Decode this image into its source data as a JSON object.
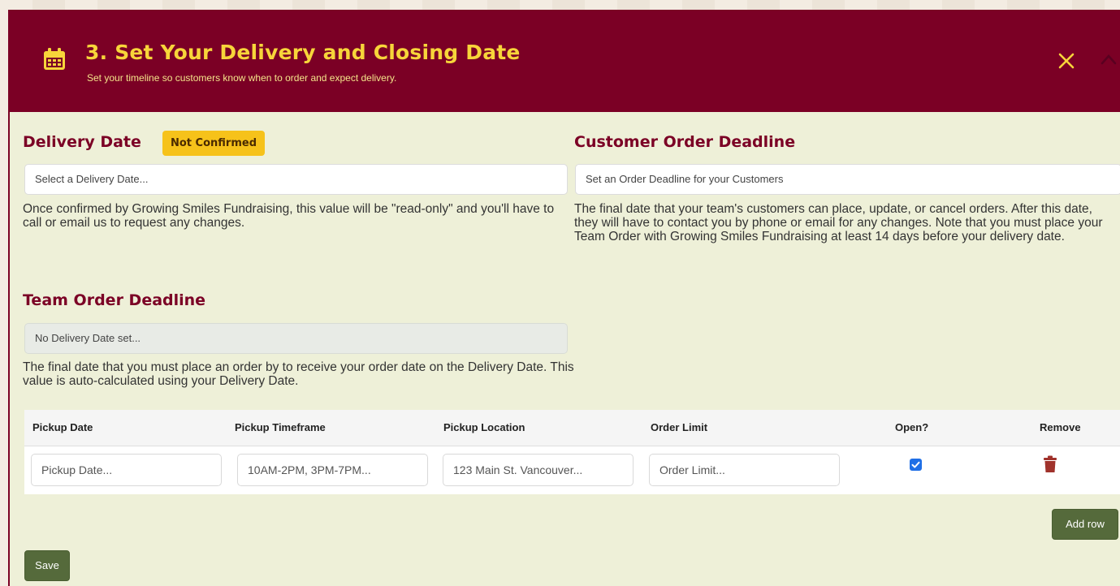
{
  "header": {
    "title": "3. Set Your Delivery and Closing Date",
    "subtitle": "Set your timeline so customers know when to order and expect delivery.",
    "icon": "calendar-icon",
    "colors": {
      "background": "#7b0025",
      "title": "#f7d53a",
      "subtitle": "#f4e48a"
    }
  },
  "delivery": {
    "title": "Delivery Date",
    "badge": "Not Confirmed",
    "input_placeholder": "Select a Delivery Date...",
    "help": "Once confirmed by Growing Smiles Fundraising, this value will be \"read-only\" and you'll have to call or email us to request any changes."
  },
  "customer_deadline": {
    "title": "Customer Order Deadline",
    "input_placeholder": "Set an Order Deadline for your Customers",
    "help": "The final date that your team's customers can place, update, or cancel orders. After this date, they will have to contact you by phone or email for any changes. Note that you must place your Team Order with Growing Smiles Fundraising at least 14 days before your delivery date."
  },
  "team_deadline": {
    "title": "Team Order Deadline",
    "input_value": "No Delivery Date set...",
    "help": "The final date that you must place an order by to receive your order date on the Delivery Date. This value is auto-calculated using your Delivery Date."
  },
  "pickup_table": {
    "headers": [
      "Pickup Date",
      "Pickup Timeframe",
      "Pickup Location",
      "Order Limit",
      "Open?",
      "Remove"
    ],
    "rows": [
      {
        "pickup_date_placeholder": "Pickup Date...",
        "timeframe_placeholder": "10AM-2PM, 3PM-7PM...",
        "location_placeholder": "123 Main St. Vancouver...",
        "order_limit_placeholder": "Order Limit...",
        "open": true
      }
    ]
  },
  "buttons": {
    "add_row": "Add row",
    "save": "Save"
  },
  "colors": {
    "accent": "#7b0025",
    "badge": "#f6c21a",
    "button": "#556a3b",
    "checkbox": "#1f6fe6",
    "trash": "#a0322b"
  }
}
